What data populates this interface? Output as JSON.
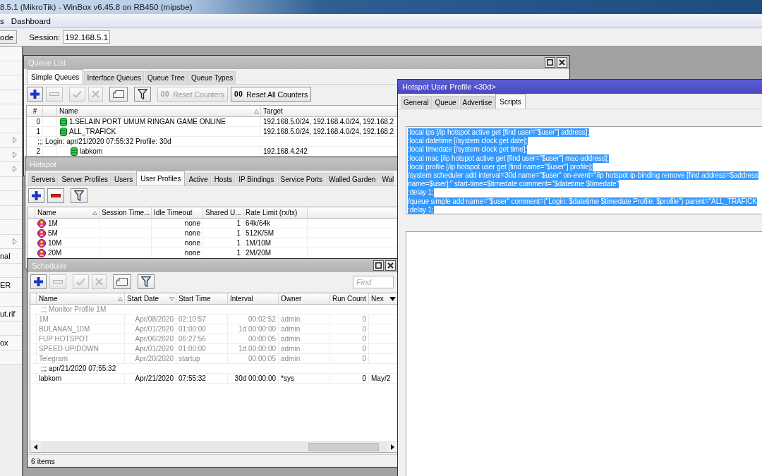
{
  "window": {
    "title": "8.5.1 (MikroTik) - WinBox v6.45.8 on RB450 (mipsbe)"
  },
  "menu": {
    "items": [
      "s",
      "Dashboard"
    ]
  },
  "toolbar": {
    "mode_button": "ode",
    "session_label": "Session:",
    "session_value": "192.168.5.1"
  },
  "sidebar": {
    "items": [
      {
        "submenu": false
      },
      {
        "submenu": false
      },
      {
        "submenu": false
      },
      {
        "submenu": false
      },
      {
        "submenu": false
      },
      {
        "submenu": false
      },
      {
        "submenu": true
      },
      {
        "submenu": true
      },
      {
        "submenu": true
      },
      {
        "submenu": false
      },
      {
        "submenu": false
      },
      {
        "submenu": false
      },
      {
        "submenu": false
      },
      {
        "submenu": true
      },
      {
        "label": "nal",
        "submenu": false
      },
      {
        "submenu": false
      },
      {
        "label": "ER",
        "submenu": false
      },
      {
        "submenu": false
      },
      {
        "label": "ut.rif",
        "submenu": false
      },
      {
        "submenu": false
      },
      {
        "label": "ox",
        "submenu": false
      },
      {
        "submenu": false
      }
    ]
  },
  "queue_list": {
    "title": "Queue List",
    "active": false,
    "window_buttons": true,
    "tabs": [
      {
        "label": "Simple Queues",
        "selected": true
      },
      {
        "label": "Interface Queues",
        "selected": false
      },
      {
        "label": "Queue Tree",
        "selected": false
      },
      {
        "label": "Queue Types",
        "selected": false
      }
    ],
    "tools": [
      {
        "kind": "add",
        "disabled": false
      },
      {
        "kind": "remove",
        "disabled": true
      },
      {
        "kind": "enable",
        "disabled": true
      },
      {
        "kind": "disable",
        "disabled": true
      },
      {
        "kind": "comment",
        "disabled": false
      },
      {
        "kind": "filter",
        "disabled": false
      },
      {
        "kind": "counter",
        "glyph": "00",
        "label": "Reset Counters",
        "disabled": true
      },
      {
        "kind": "counter",
        "glyph": "00",
        "label": "Reset All Counters",
        "disabled": false
      }
    ],
    "table": {
      "columns": [
        {
          "label": "#"
        },
        {
          "label": "Name",
          "sorted": true,
          "descending": false
        },
        {
          "label": "Target"
        }
      ],
      "rows": [
        {
          "number": "0",
          "name": "1.SELAIN PORT UMUM RINGAN GAME ONLINE",
          "target": "192.168.5.0/24, 192.168.4.0/24, 192.168.2"
        },
        {
          "number": "1",
          "name": "ALL_TRAFICK",
          "target": "192.168.5.0/24, 192.168.4.0/24, 192.168.2",
          "children": [
            {
              "comment": ";;; Login: apr/21/2020 07:55:32 Profile: 30d",
              "number": "2",
              "name": "labkom",
              "target": "192.168.4.242"
            }
          ]
        }
      ]
    }
  },
  "hotspot": {
    "title": "Hotspot",
    "active": false,
    "tabs": [
      {
        "label": "Servers",
        "selected": false
      },
      {
        "label": "Server Profiles",
        "selected": false
      },
      {
        "label": "Users",
        "selected": false
      },
      {
        "label": "User Profiles",
        "selected": true
      },
      {
        "label": "Active",
        "selected": false
      },
      {
        "label": "Hosts",
        "selected": false
      },
      {
        "label": "IP Bindings",
        "selected": false
      },
      {
        "label": "Service Ports",
        "selected": false
      },
      {
        "label": "Walled Garden",
        "selected": false
      },
      {
        "label": "Wal",
        "selected": false
      }
    ],
    "tools": [
      {
        "kind": "add",
        "disabled": false
      },
      {
        "kind": "remove",
        "disabled": false
      },
      {
        "kind": "filter",
        "disabled": false
      }
    ],
    "table": {
      "columns": [
        {
          "label": "Name",
          "sorted": true,
          "descending": false
        },
        {
          "label": "Session Time..."
        },
        {
          "label": "Idle Timeout"
        },
        {
          "label": "Shared U..."
        },
        {
          "label": "Rate Limit (rx/tx)"
        }
      ],
      "rows": [
        {
          "name": "1M",
          "idle_timeout": "none",
          "shared_users": "1",
          "rate_limit": "64k/64k"
        },
        {
          "name": "5M",
          "idle_timeout": "none",
          "shared_users": "1",
          "rate_limit": "512K/5M"
        },
        {
          "name": "10M",
          "idle_timeout": "none",
          "shared_users": "1",
          "rate_limit": "1M/10M"
        },
        {
          "name": "20M",
          "idle_timeout": "none",
          "shared_users": "1",
          "rate_limit": "2M/20M"
        }
      ]
    }
  },
  "scheduler": {
    "title": "Scheduler",
    "active": false,
    "window_buttons": true,
    "tools": [
      {
        "kind": "add",
        "disabled": false
      },
      {
        "kind": "remove",
        "disabled": true
      },
      {
        "kind": "enable",
        "disabled": true
      },
      {
        "kind": "disable",
        "disabled": true
      },
      {
        "kind": "comment",
        "disabled": false
      },
      {
        "kind": "filter",
        "disabled": false
      }
    ],
    "find": {
      "placeholder": "Find"
    },
    "table": {
      "column_menu": true,
      "columns": [
        {
          "label": "Name",
          "sorted": true,
          "descending": false
        },
        {
          "label": "Start Date",
          "sorted": true,
          "descending": true
        },
        {
          "label": "Start Time"
        },
        {
          "label": "Interval"
        },
        {
          "label": "Owner"
        },
        {
          "label": "Run Count"
        },
        {
          "label": "Nex"
        }
      ],
      "rows": [
        {
          "comment": ";;; Monitor Profile 1M",
          "name": "1M",
          "start_date": "Apr/08/2020",
          "start_time": "02:10:57",
          "interval": "00:02:52",
          "owner": "admin",
          "run_count": "0",
          "disabled": true
        },
        {
          "name": "BULANAN_10M",
          "start_date": "Apr/01/2020",
          "start_time": "01:00:00",
          "interval": "1d 00:00:00",
          "owner": "admin",
          "run_count": "0",
          "disabled": true
        },
        {
          "name": "FUP HOTSPOT",
          "start_date": "Apr/06/2020",
          "start_time": "06:27:56",
          "interval": "00:00:05",
          "owner": "admin",
          "run_count": "0",
          "disabled": true
        },
        {
          "name": "SPEED UP/DOWN",
          "start_date": "Apr/01/2020",
          "start_time": "01:00:00",
          "interval": "1d 00:00:00",
          "owner": "admin",
          "run_count": "0",
          "disabled": true
        },
        {
          "name": "Telegram",
          "start_date": "Apr/20/2020",
          "start_time": "startup",
          "interval": "00:00:05",
          "owner": "admin",
          "run_count": "0",
          "disabled": true
        },
        {
          "comment": ";;; apr/21/2020 07:55:32",
          "name": "labkom",
          "start_date": "Apr/21/2020",
          "start_time": "07:55:32",
          "interval": "30d 00:00:00",
          "owner": "*sys",
          "run_count": "0",
          "next_run": "May/2",
          "disabled": false
        }
      ]
    },
    "status": "6 items"
  },
  "user_profile": {
    "title": "Hotspot User Profile <30d>",
    "active": true,
    "tabs": [
      {
        "label": "General",
        "selected": false
      },
      {
        "label": "Queue",
        "selected": false
      },
      {
        "label": "Advertise",
        "selected": false
      },
      {
        "label": "Scripts",
        "selected": true
      }
    ],
    "script_fields": [
      {
        "kind": "script",
        "selected": true,
        "lines": [
          ":local ips [/ip hotspot active get [find user=\"$user\"] address];",
          ":local datetime [/system clock get date];",
          ":local timedate [/system clock get time];",
          ":local mac [/ip hotspot active get [find user=\"$user\"] mac-address];",
          ":local profile [/ip hotspot user get [find name=\"$user\"] profile];",
          "/system scheduler add interval=30d name=\"$user\" on-event=\"/ip hotspot ip-binding remove [find address=$address",
          "name=$user];\" start-time=$timedate comment=\"$datetime $timedate\"",
          ":delay 1;",
          "/queue simple add name=\"$user\" comment=(\"Login: $datetime $timedate Profile: $profile\") parent=\"ALL_TRAFICK",
          ":delay 1;"
        ]
      },
      {
        "kind": "script"
      }
    ]
  }
}
